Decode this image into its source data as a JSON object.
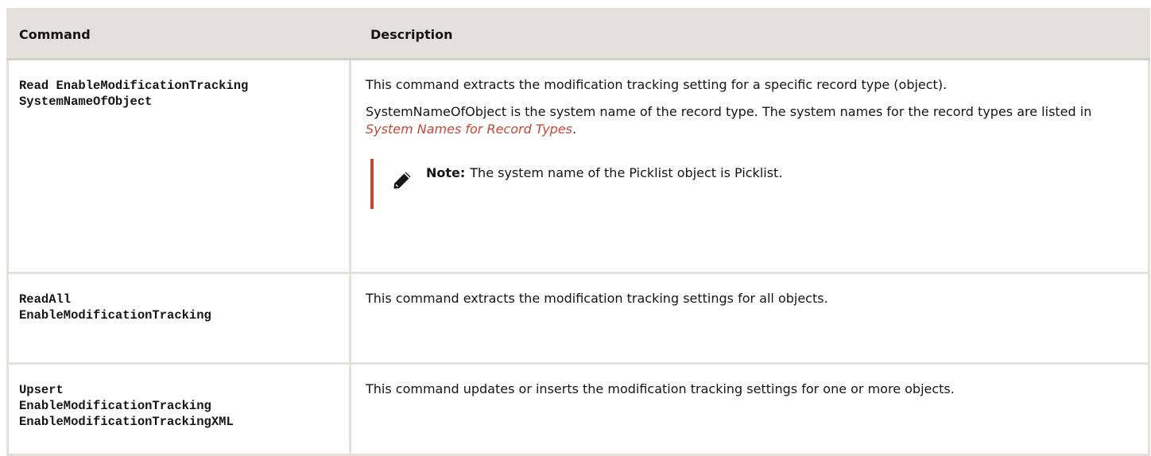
{
  "table": {
    "headers": {
      "command": "Command",
      "description": "Description"
    },
    "rows": [
      {
        "command_lines": [
          "Read EnableModificationTracking",
          "SystemNameOfObject"
        ],
        "description": "This command extracts the modification tracking setting for a specific record type (object).",
        "detail_prefix": "SystemNameOfObject is the system name of the record type. The system names for the record types are listed in ",
        "detail_link": "System Names for Record Types",
        "detail_suffix": ".",
        "note_label": "Note:",
        "note_text": "The system name of the Picklist object is Picklist."
      },
      {
        "command_lines": [
          "ReadAll",
          "EnableModificationTracking"
        ],
        "description": "This command extracts the modification tracking settings for all objects."
      },
      {
        "command_lines": [
          "Upsert",
          "EnableModificationTracking",
          "EnableModificationTrackingXML"
        ],
        "description": "This command updates or inserts the modification tracking settings for one or more objects."
      }
    ]
  },
  "icons": {
    "note": "pencil-icon"
  },
  "colors": {
    "header_bg": "#e4e1dc",
    "link": "#c74634",
    "note_bar": "#c74634"
  }
}
